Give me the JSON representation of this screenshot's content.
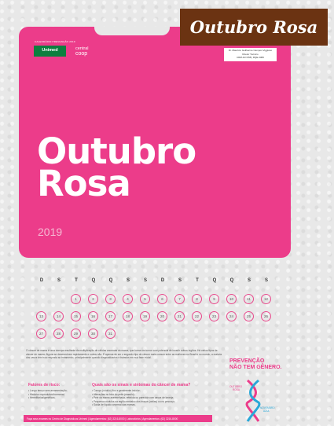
{
  "banner": {
    "title": "Outubro Rosa"
  },
  "poster": {
    "top_line": "CALENDÁRIO PREVENÇÃO 2019",
    "logo_main": "Unimed",
    "logo_second_line1": "central",
    "logo_second_line2": "coop",
    "doctor_line1": "Dr. Maurício Guilherme Campos Viggiano",
    "doctor_line2": "Diretor Técnico",
    "doctor_line3": "CRM-GO 958 | RQE 2380",
    "title_line1": "Outubro",
    "title_line2": "Rosa",
    "year": "2019"
  },
  "calendar": {
    "weekdays": [
      "D",
      "S",
      "T",
      "Q",
      "Q",
      "S",
      "S",
      "D",
      "S",
      "T",
      "Q",
      "Q",
      "S",
      "S"
    ],
    "days": [
      "1",
      "2",
      "3",
      "4",
      "5",
      "6",
      "7",
      "8",
      "9",
      "10",
      "11",
      "12",
      "13",
      "14",
      "15",
      "16",
      "17",
      "18",
      "19",
      "20",
      "21",
      "22",
      "23",
      "24",
      "25",
      "26",
      "27",
      "28",
      "29",
      "30",
      "31"
    ]
  },
  "info": {
    "body": "O câncer de mama é uma doença resultante da multiplicação de células anormais da mama, que forma um tumor com potencial de invadir outros órgãos. Há vários tipos de câncer de mama. Alguns se desenvolvem rapidamente e outros não. É apenas de ser o segundo tipo de câncer mais comum entre as mulheres no Brasil e no mundo, a maioria dos casos tem boa resposta ao tratamento, principalmente quando diagnosticados e tratados em sua fase inicial.",
    "risk_title": "Fatores de risco:",
    "risk_items": [
      "• Longo tempo sem amamentação;",
      "• Histórico reprodutivo/hormonal;",
      "• Hereditários/genéticos."
    ],
    "signs_title": "Quais são os sinais e sintomas do câncer de mama?",
    "signs_items": [
      "• Caroço (nódulo) fixo e geralmente indolor;",
      "• Alterações no bico do peito (mamilo);",
      "• Pele da mama avermelhada, retraída ou parecida com casca de laranja;",
      "• Pequenos nódulos na região embaixo dos braços (axilas) ou no pescoço;",
      "• Saída de líquido anormal das mamas."
    ],
    "prevention_line1": "PREVENÇÃO",
    "prevention_line2": "NÃO TEM GÊNERO.",
    "label_pink1": "OUTUBRO",
    "label_pink2": "ROSA",
    "label_blue1": "NOVEMBRO",
    "label_blue2": "AZUL",
    "footer": "Faça seus exames no Centro de Diagnósticos Unimed | Agendamentos: (62) 3216-8000 | Laboratórios | Agendamentos: (62) 3216-8000"
  },
  "colors": {
    "pink": "#ec3c8a",
    "banner": "#6b3312",
    "green": "#0d7f3f",
    "blue": "#2aa8d8"
  }
}
